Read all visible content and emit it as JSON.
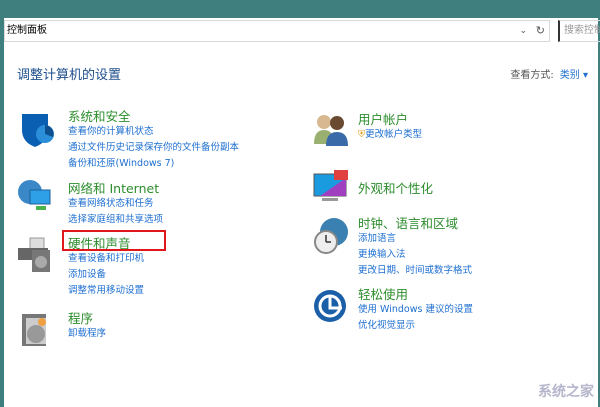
{
  "address_bar": {
    "path": "控制面板",
    "search_placeholder": "搜索控制面板"
  },
  "heading": "调整计算机的设置",
  "view_by": {
    "label": "查看方式:",
    "value": "类别"
  },
  "left": [
    {
      "title": "系统和安全",
      "links": [
        "查看你的计算机状态",
        "通过文件历史记录保存你的文件备份副本",
        "备份和还原(Windows 7)"
      ]
    },
    {
      "title": "网络和 Internet",
      "links": [
        "查看网络状态和任务",
        "选择家庭组和共享选项"
      ]
    },
    {
      "title": "硬件和声音",
      "links": [
        "查看设备和打印机",
        "添加设备",
        "调整常用移动设置"
      ]
    },
    {
      "title": "程序",
      "links": [
        "卸载程序"
      ]
    }
  ],
  "right": [
    {
      "title": "用户帐户",
      "links": [
        "更改帐户类型"
      ]
    },
    {
      "title": "外观和个性化",
      "links": []
    },
    {
      "title": "时钟、语言和区域",
      "links": [
        "添加语言",
        "更换输入法",
        "更改日期、时间或数字格式"
      ]
    },
    {
      "title": "轻松使用",
      "links": [
        "使用 Windows 建议的设置",
        "优化视觉显示"
      ]
    }
  ],
  "watermark": "系统之家"
}
